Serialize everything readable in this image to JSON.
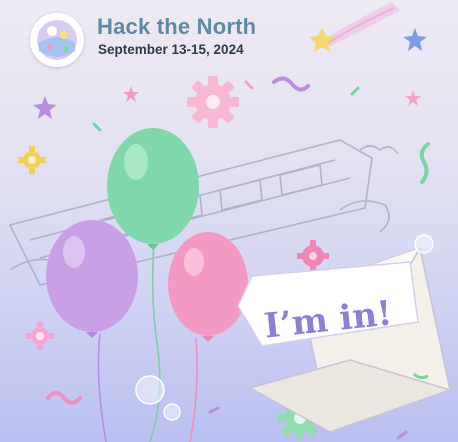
{
  "header": {
    "title": "Hack the North",
    "subtitle": "September 13-15, 2024"
  },
  "badge": {
    "label": "I’m in!"
  },
  "colors": {
    "background_top": "#eeeaf3",
    "background_bottom": "#b9bff0",
    "title": "#5e8aa3",
    "subtitle": "#2f3a4a",
    "badge_text": "#8d7fd6",
    "balloon_green": "#79d6a9",
    "balloon_purple": "#c79be6",
    "balloon_pink": "#f39bc4"
  },
  "icons": [
    "logo-icon",
    "shooting-star-icon",
    "star-icon",
    "gear-icon",
    "confetti-icon",
    "balloon-icon",
    "train-sketch",
    "envelope-icon",
    "bubble-icon"
  ]
}
